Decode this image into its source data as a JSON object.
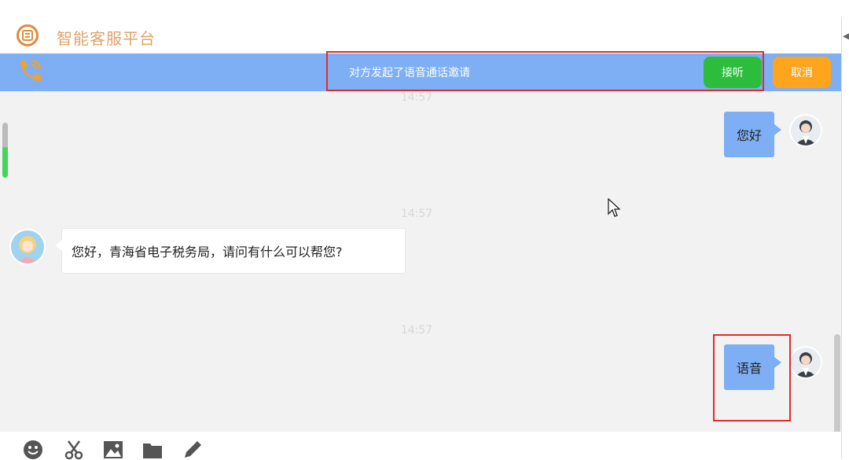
{
  "header": {
    "title": "智能客服平台"
  },
  "call": {
    "message": "对方发起了语音通话邀请",
    "accept_label": "接听",
    "cancel_label": "取消"
  },
  "messages": [
    {
      "time": "14:57",
      "text": "您好",
      "direction": "out"
    },
    {
      "time": "14:57",
      "text": "您好，青海省电子税务局，请问有什么可以帮您?",
      "direction": "in"
    },
    {
      "time": "14:57",
      "text": "语音",
      "direction": "out"
    }
  ],
  "toolbar": {
    "icons": [
      "emoji-icon",
      "scissors-icon",
      "image-icon",
      "folder-icon",
      "pencil-icon"
    ]
  },
  "colors": {
    "accent": "#7eaef3",
    "accept": "#2dbd3c",
    "cancel": "#ffa41d",
    "brand": "#e08a3a",
    "highlight": "#e02b2b"
  }
}
